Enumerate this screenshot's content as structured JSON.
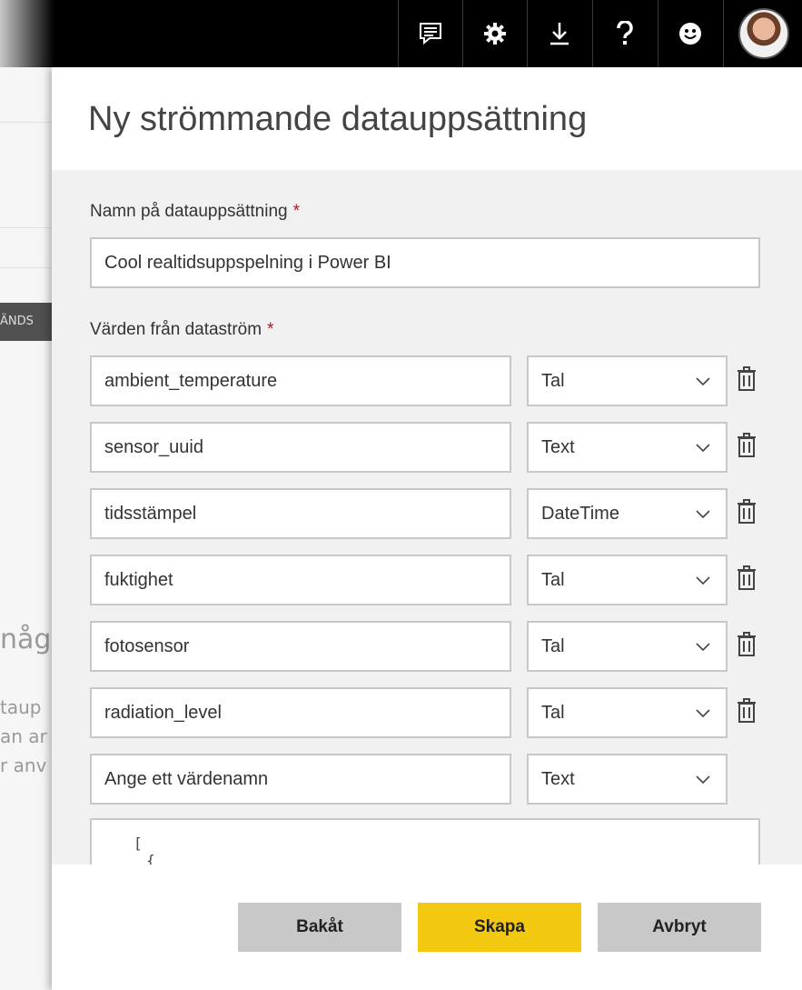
{
  "topbar": {
    "icons": [
      "feedback-icon",
      "gear-icon",
      "download-icon",
      "help-icon",
      "smiley-icon"
    ],
    "avatar": "user-avatar"
  },
  "background": {
    "dark_bar_text": "ÄNDS",
    "heading_fragment": "någ",
    "text_lines": [
      "taup",
      "an ar",
      "r anv"
    ]
  },
  "panel": {
    "title": "Ny strömmande datauppsättning",
    "name_label": "Namn på datauppsättning",
    "required_mark": "*",
    "name_value": "Cool realtidsuppspelning i Power BI",
    "values_label": "Värden från dataström",
    "values": [
      {
        "name": "ambient_temperature",
        "type": "Tal"
      },
      {
        "name": "sensor_uuid",
        "type": "Text"
      },
      {
        "name": "tidsstämpel",
        "type": "DateTime"
      },
      {
        "name": "fuktighet",
        "type": "Tal"
      },
      {
        "name": "fotosensor",
        "type": "Tal"
      },
      {
        "name": "radiation_level",
        "type": "Tal"
      }
    ],
    "new_value_placeholder": "Ange ett värdenamn",
    "new_value_type": "Text",
    "json_preview": "[",
    "json_preview_line2": "{"
  },
  "buttons": {
    "back": "Bakåt",
    "create": "Skapa",
    "cancel": "Avbryt"
  },
  "colors": {
    "accent": "#f2c811",
    "topbar": "#000000",
    "required": "#c50f1f"
  }
}
